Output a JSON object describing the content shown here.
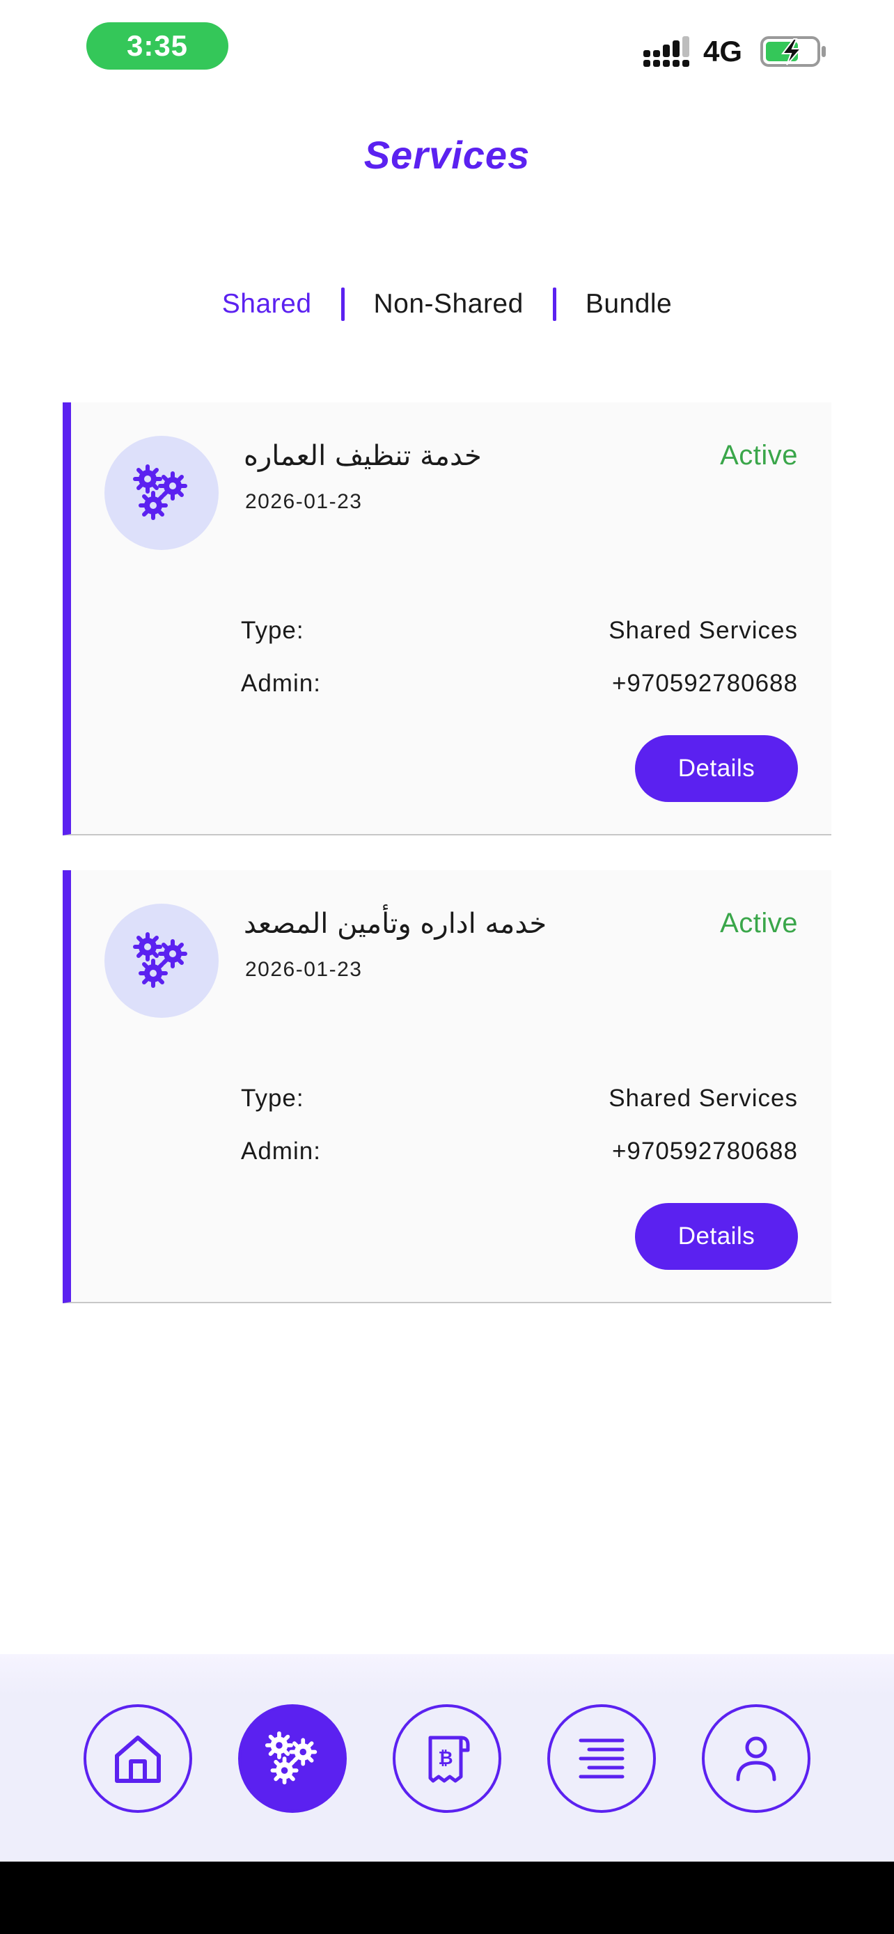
{
  "status_bar": {
    "time": "3:35",
    "network": "4G",
    "time_pill_color": "#34c759",
    "icons": [
      "signal-bars-icon",
      "battery-charging-icon"
    ]
  },
  "header": {
    "title": "Services"
  },
  "tabs": [
    {
      "label": "Shared",
      "active": true
    },
    {
      "label": "Non-Shared",
      "active": false
    },
    {
      "label": "Bundle",
      "active": false
    }
  ],
  "cards": [
    {
      "icon": "gears-icon",
      "name": "خدمة تنظيف العماره",
      "date": "2026-01-23",
      "status": "Active",
      "type_label": "Type:",
      "type_value": "Shared Services",
      "admin_label": "Admin:",
      "admin_value": "+970592780688",
      "button_label": "Details"
    },
    {
      "icon": "gears-icon",
      "name": "خدمه اداره وتأمين المصعد",
      "date": "2026-01-23",
      "status": "Active",
      "type_label": "Type:",
      "type_value": "Shared Services",
      "admin_label": "Admin:",
      "admin_value": "+970592780688",
      "button_label": "Details"
    }
  ],
  "bottom_nav": {
    "items": [
      {
        "icon": "home-icon",
        "active": false
      },
      {
        "icon": "gears-icon",
        "active": true
      },
      {
        "icon": "bitcoin-receipt-icon",
        "active": false
      },
      {
        "icon": "menu-list-icon",
        "active": false
      },
      {
        "icon": "user-icon",
        "active": false
      }
    ]
  },
  "colors": {
    "accent": "#5b21f0",
    "status_active": "#3aa64a",
    "avatar_bg": "#dde0fa",
    "card_bg": "#fafafa",
    "nav_bg": "#eeeefb"
  }
}
